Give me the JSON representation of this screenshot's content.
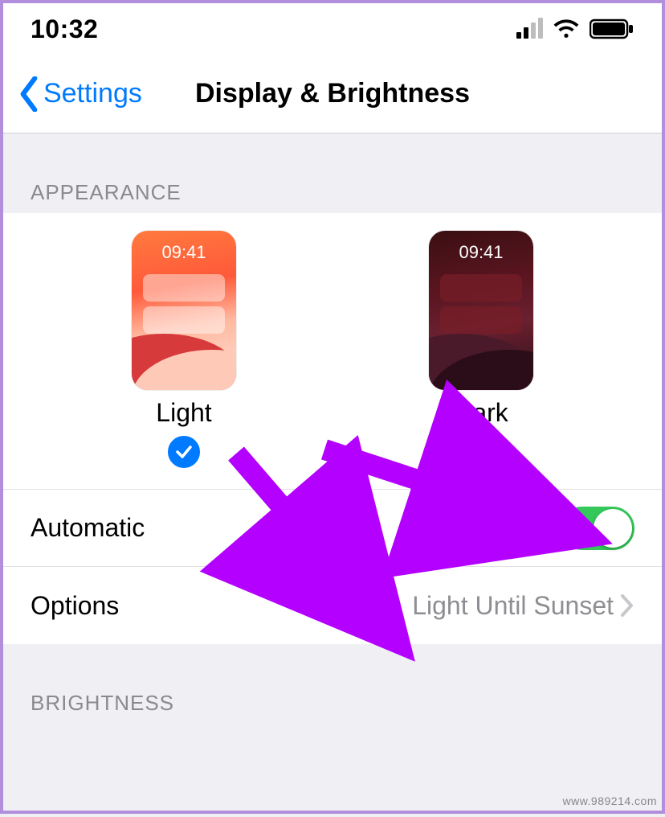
{
  "status": {
    "time": "10:32"
  },
  "nav": {
    "back_label": "Settings",
    "title": "Display & Brightness"
  },
  "sections": {
    "appearance_header": "APPEARANCE",
    "brightness_header": "BRIGHTNESS"
  },
  "appearance": {
    "preview_clock": "09:41",
    "light_label": "Light",
    "dark_label": "Dark",
    "selected": "light"
  },
  "rows": {
    "automatic_label": "Automatic",
    "automatic_on": true,
    "options_label": "Options",
    "options_value": "Light Until Sunset"
  },
  "watermark": "www.989214.com"
}
